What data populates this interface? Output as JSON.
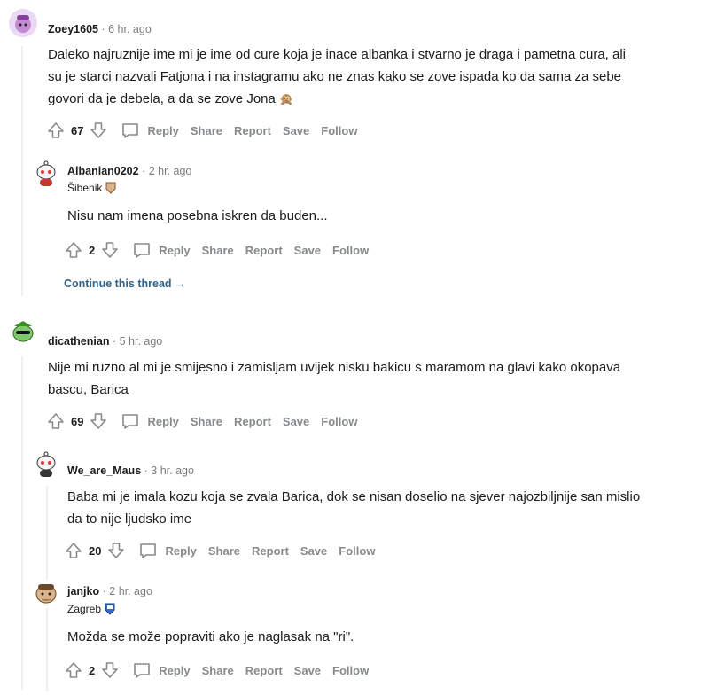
{
  "comments": [
    {
      "user": "Zoey1605",
      "time": "6 hr. ago",
      "text_lines": [
        "Daleko najruznije ime mi je ime od cure koja je inace albanka i stvarno je draga i pametna cura, ali",
        "su je starci nazvali Fatjona i na instagramu ako ne znas kako se zove ispada ko da sama za sebe",
        "govori da je debela, a da se zove Jona"
      ],
      "emoji": "🙊",
      "score": "67",
      "avatar": "zoey-avatar"
    },
    {
      "user": "Albanian0202",
      "time": "2 hr. ago",
      "flair": "Šibenik",
      "text_lines": [
        "Nisu nam imena posebna iskren da buden..."
      ],
      "score": "2",
      "continue": "Continue this thread →",
      "avatar": "albanian-avatar"
    },
    {
      "user": "dicathenian",
      "time": "5 hr. ago",
      "text_lines": [
        "Nije mi ruzno al mi je smijesno i zamisljam uvijek nisku bakicu s maramom na glavi kako okopava",
        "bascu, Barica"
      ],
      "score": "69",
      "avatar": "dicathenian-avatar"
    },
    {
      "user": "We_are_Maus",
      "time": "3 hr. ago",
      "text_lines": [
        "Baba mi je imala kozu koja se zvala Barica, dok se nisan doselio na sjever najozbiljnije san mislio",
        "da to nije ljudsko ime"
      ],
      "score": "20",
      "avatar": "maus-avatar"
    },
    {
      "user": "janjko",
      "time": "2 hr. ago",
      "flair": "Zagreb",
      "text_lines": [
        "Možda se može popraviti ako je naglasak na \"ri\"."
      ],
      "score": "2",
      "avatar": "janjko-avatar"
    }
  ],
  "actions": {
    "reply": "Reply",
    "share": "Share",
    "report": "Report",
    "save": "Save",
    "follow": "Follow"
  },
  "separator": "·"
}
